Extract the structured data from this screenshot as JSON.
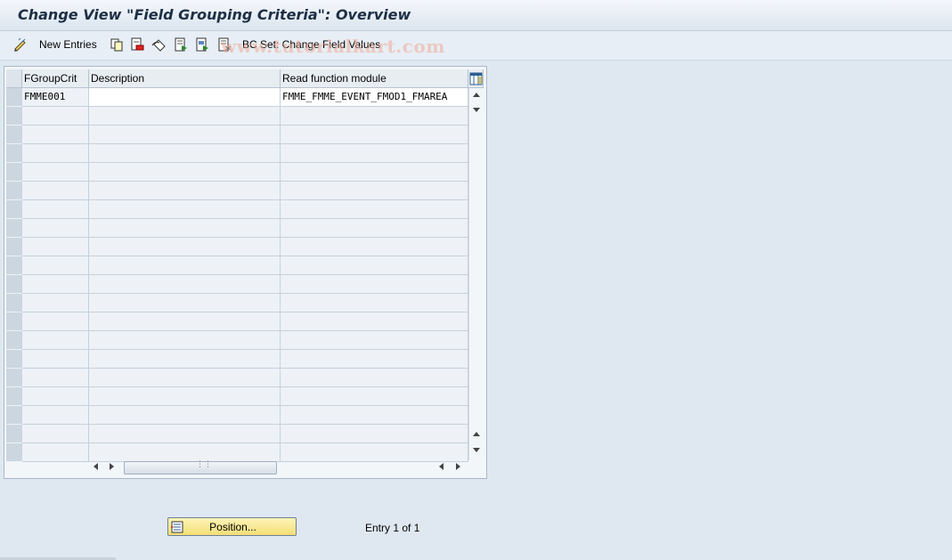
{
  "window": {
    "title": "Change View \"Field Grouping Criteria\": Overview"
  },
  "toolbar": {
    "new_entries_label": "New Entries",
    "bc_set_label": "BC Set: Change Field Values",
    "icons": [
      "edit-pencil-icon",
      "copy-icon",
      "delete-icon",
      "undo-icon",
      "select-all-icon",
      "select-block-icon",
      "deselect-all-icon"
    ]
  },
  "watermark": "www.tutorialkart.com",
  "table": {
    "columns": [
      "FGroupCrit",
      "Description",
      "Read function module"
    ],
    "rows": [
      {
        "fgroupcrit": "FMME001",
        "description": "",
        "read_function_module": "FMME_FMME_EVENT_FMOD1_FMAREA"
      }
    ]
  },
  "footer": {
    "position_button_label": "Position...",
    "entry_text": "Entry 1 of 1"
  },
  "colors": {
    "accent_button": "#f4de76",
    "title_text": "#1d2f45"
  }
}
